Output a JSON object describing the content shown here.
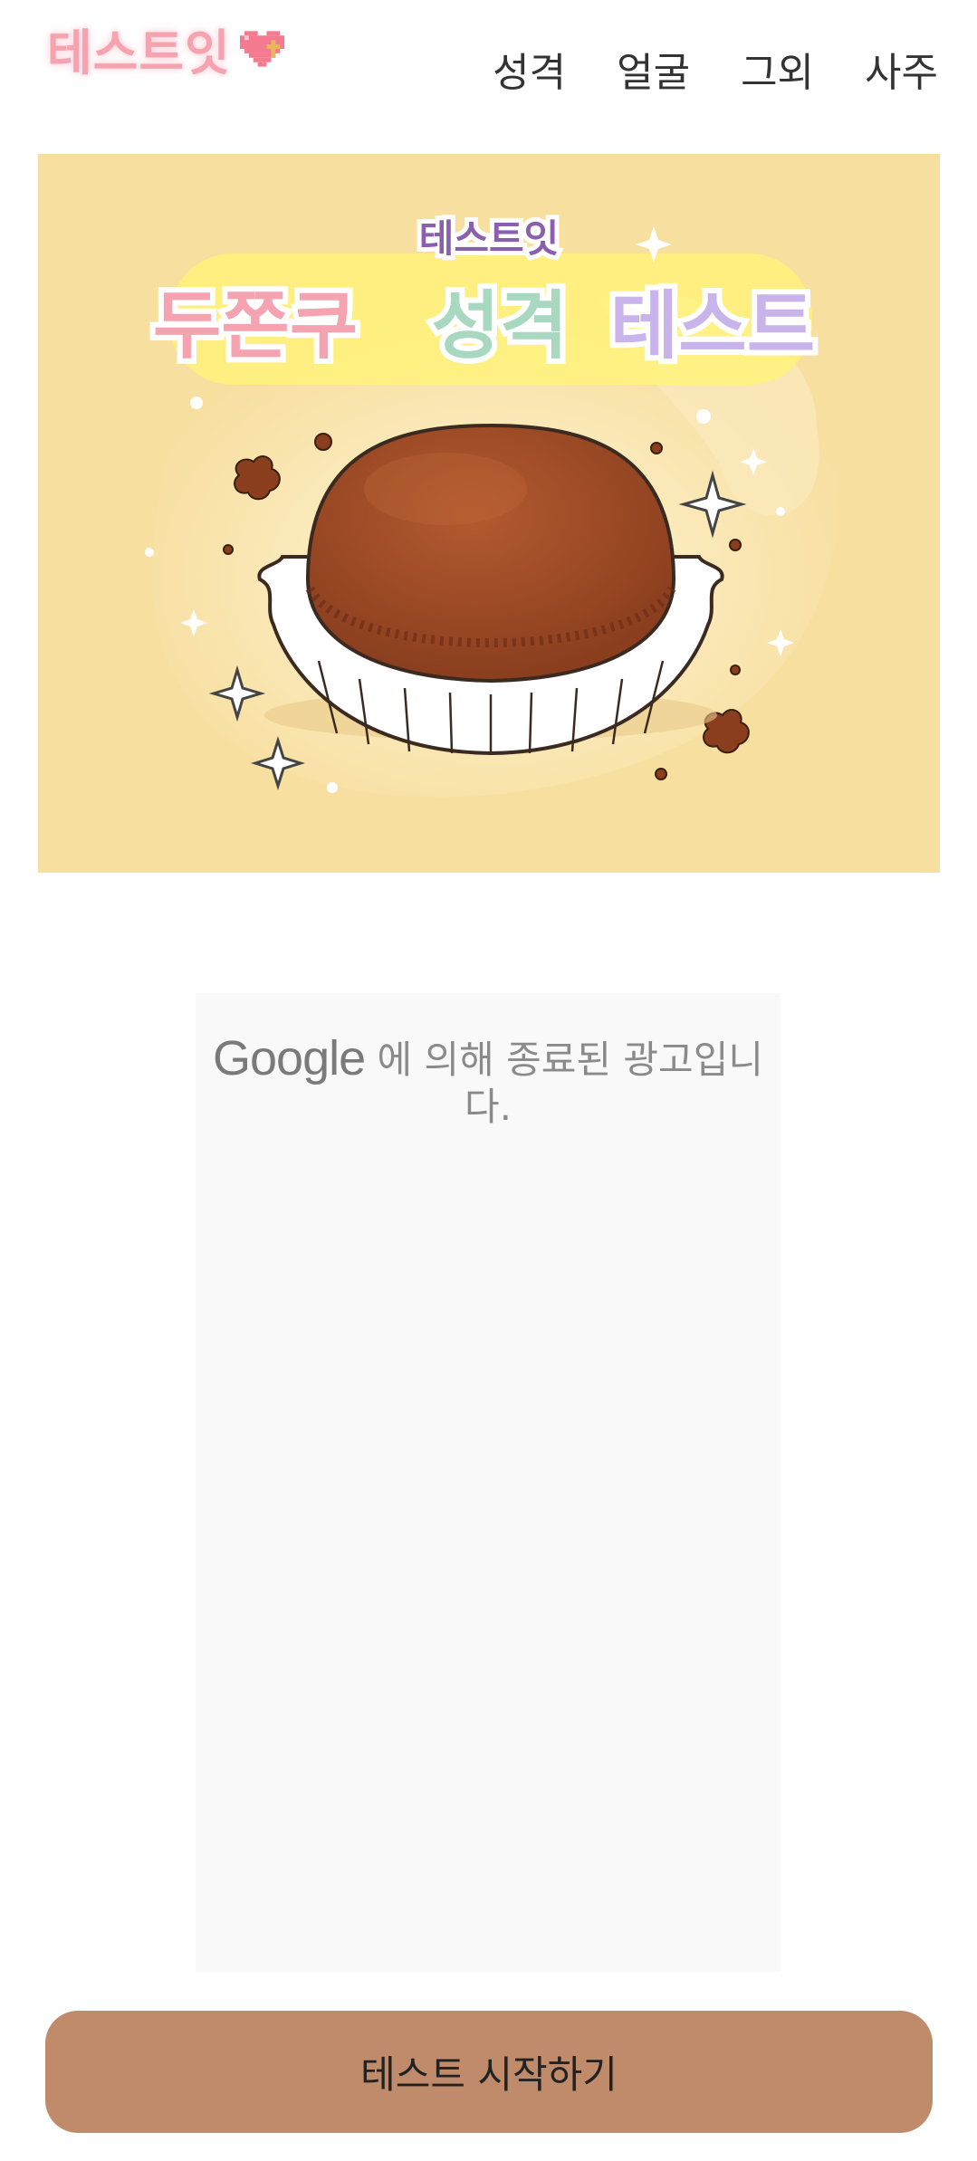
{
  "header": {
    "logo_text": "테스트잇",
    "nav": [
      {
        "label": "성격"
      },
      {
        "label": "얼굴"
      },
      {
        "label": "그외"
      },
      {
        "label": "사주"
      }
    ]
  },
  "hero": {
    "small_title": "테스트잇",
    "title_part1": "두쫀쿠",
    "title_part2": "성격",
    "title_part3": "테스트",
    "colors": {
      "bg": "#f7dfa0",
      "cookie": "#a0502a",
      "part1": "#f6a3b1",
      "part2": "#a9d8c0",
      "part3": "#c8b3ea"
    }
  },
  "ad": {
    "brand": "Google",
    "message": "에 의해 종료된 광고입니다."
  },
  "cta": {
    "label": "테스트 시작하기",
    "color": "#bf8b6a"
  }
}
